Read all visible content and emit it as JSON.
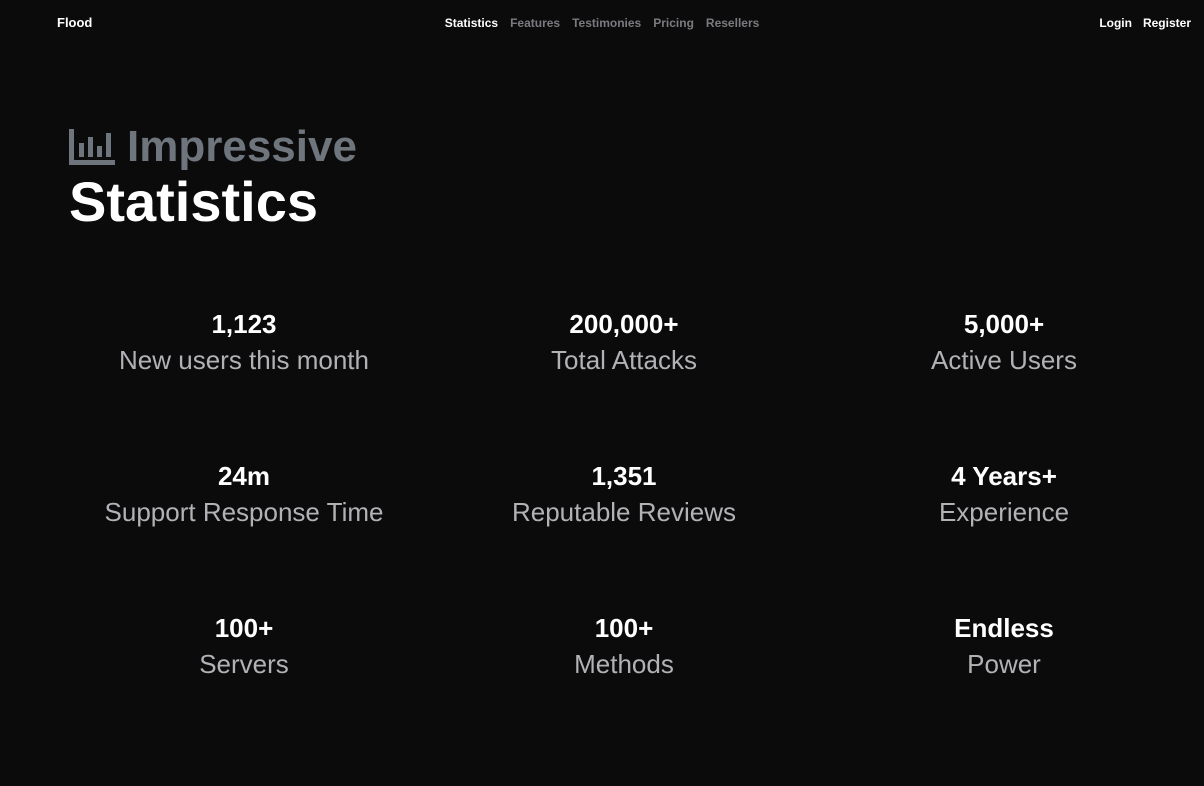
{
  "nav": {
    "brand": "Flood",
    "links": [
      {
        "label": "Statistics",
        "active": true
      },
      {
        "label": "Features",
        "active": false
      },
      {
        "label": "Testimonies",
        "active": false
      },
      {
        "label": "Pricing",
        "active": false
      },
      {
        "label": "Resellers",
        "active": false
      }
    ],
    "login": "Login",
    "register": "Register"
  },
  "heading": {
    "icon": "bar-chart-icon",
    "subtitle": "Impressive",
    "title": "Statistics"
  },
  "stats": [
    {
      "value": "1,123",
      "label": "New users this month"
    },
    {
      "value": "200,000+",
      "label": "Total Attacks"
    },
    {
      "value": "5,000+",
      "label": "Active Users"
    },
    {
      "value": "24m",
      "label": "Support Response Time"
    },
    {
      "value": "1,351",
      "label": "Reputable Reviews"
    },
    {
      "value": "4 Years+",
      "label": "Experience"
    },
    {
      "value": "100+",
      "label": "Servers"
    },
    {
      "value": "100+",
      "label": "Methods"
    },
    {
      "value": "Endless",
      "label": "Power"
    }
  ],
  "colors": {
    "background": "#0b0b0c",
    "text_primary": "#ffffff",
    "text_muted": "#b2b2b6",
    "heading_muted": "#6f757d",
    "nav_inactive": "#7b7b7f"
  }
}
